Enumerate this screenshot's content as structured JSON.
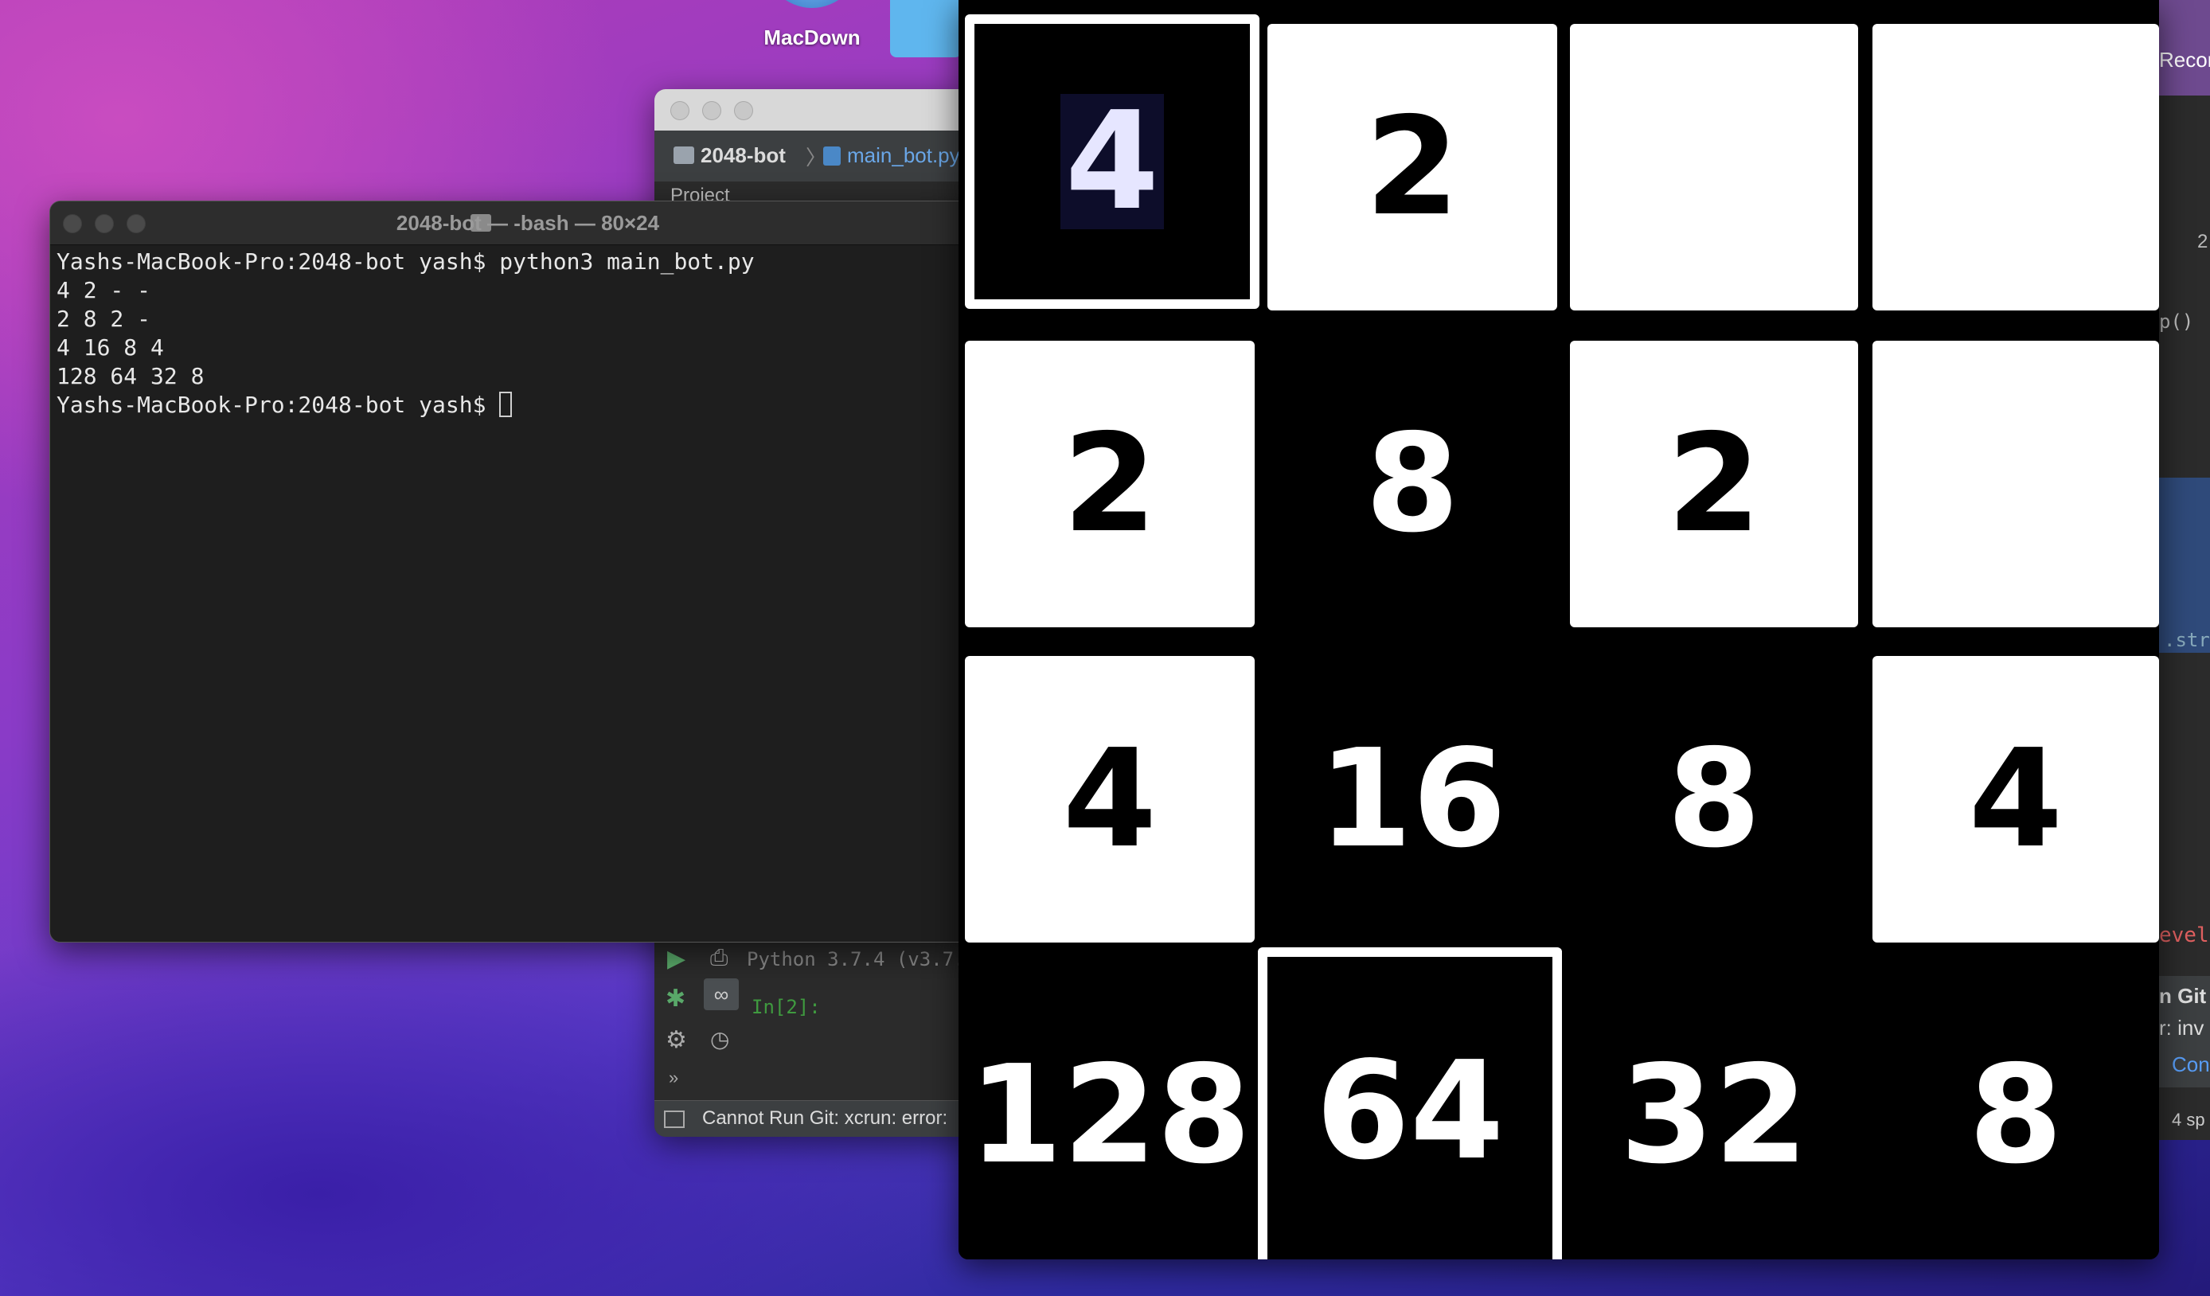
{
  "desktop": {
    "app_label": "MacDown"
  },
  "ide": {
    "project": "2048-bot",
    "file_tab": "main_bot.py",
    "sidebar_label": "Project",
    "console_version": "Python 3.7.4 (v3.7.",
    "prompt": "In[2]:",
    "status": "Cannot Run Git: xcrun: error:"
  },
  "right_window": {
    "title_fragment": "Recor",
    "fragments": [
      "2",
      "p()",
      ".str",
      "evel",
      "n Git",
      "r: inv",
      "Con",
      "4 sp"
    ]
  },
  "terminal": {
    "title": "2048-bot — -bash — 80×24",
    "lines": [
      "Yashs-MacBook-Pro:2048-bot yash$ python3 main_bot.py",
      "4 2 - -",
      "2 8 2 -",
      "4 16 8 4",
      "128 64 32 8",
      "Yashs-MacBook-Pro:2048-bot yash$ "
    ]
  },
  "board": {
    "rows": [
      [
        "4",
        "2",
        "",
        ""
      ],
      [
        "2",
        "8",
        "2",
        ""
      ],
      [
        "4",
        "16",
        "8",
        "4"
      ],
      [
        "128",
        "64",
        "32",
        "8"
      ]
    ],
    "styles": [
      [
        "outlined-black",
        "white",
        "white",
        "white"
      ],
      [
        "white",
        "black",
        "white",
        "white"
      ],
      [
        "white",
        "black",
        "black",
        "white"
      ],
      [
        "black",
        "outlined-black",
        "black",
        "black"
      ]
    ]
  }
}
